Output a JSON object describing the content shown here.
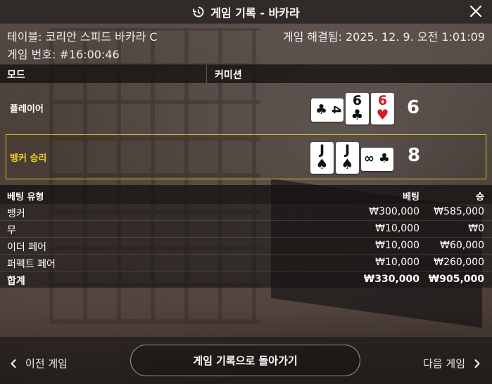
{
  "window": {
    "title": "게임 기록 - 바카라",
    "close_icon": "close-icon",
    "history_icon": "history-icon"
  },
  "info": {
    "table": "테이블: 코리안 스피드 바카라 C",
    "resolved": "게임 해결됨: 2025. 12. 9. 오전 1:01:09",
    "game_number": "게임 번호: #16:00:46"
  },
  "header": {
    "mode_label": "모드",
    "commission_label": "커미션"
  },
  "hands": {
    "player": {
      "label": "플레이어",
      "score": "6",
      "cards": [
        {
          "rank": "4",
          "suit": "♣",
          "color": "#111111",
          "orientation": "sideways"
        },
        {
          "rank": "6",
          "suit": "♣",
          "color": "#111111",
          "orientation": "upright"
        },
        {
          "rank": "6",
          "suit": "♥",
          "color": "#d01f27",
          "orientation": "upright"
        }
      ]
    },
    "banker": {
      "label": "뱅커 승리",
      "score": "8",
      "highlight_color": "#e6c21a",
      "cards": [
        {
          "rank": "J",
          "suit": "♠",
          "color": "#111111",
          "orientation": "upright"
        },
        {
          "rank": "J",
          "suit": "♠",
          "color": "#111111",
          "orientation": "upright"
        },
        {
          "rank": "∞",
          "suit": "♣",
          "color": "#111111",
          "orientation": "sideways"
        }
      ]
    }
  },
  "bets": {
    "headers": {
      "type": "베팅 유형",
      "bet": "베팅",
      "win": "승"
    },
    "rows": [
      {
        "type": "뱅커",
        "bet": "₩300,000",
        "win": "₩585,000"
      },
      {
        "type": "무",
        "bet": "₩10,000",
        "win": "₩0"
      },
      {
        "type": "이더 페어",
        "bet": "₩10,000",
        "win": "₩60,000"
      },
      {
        "type": "퍼펙트 페어",
        "bet": "₩10,000",
        "win": "₩260,000"
      }
    ],
    "total": {
      "type": "합계",
      "bet": "₩330,000",
      "win": "₩905,000"
    }
  },
  "footer": {
    "prev_label": "이전 게임",
    "back_label": "게임 기록으로 돌아가기",
    "next_label": "다음 게임"
  }
}
